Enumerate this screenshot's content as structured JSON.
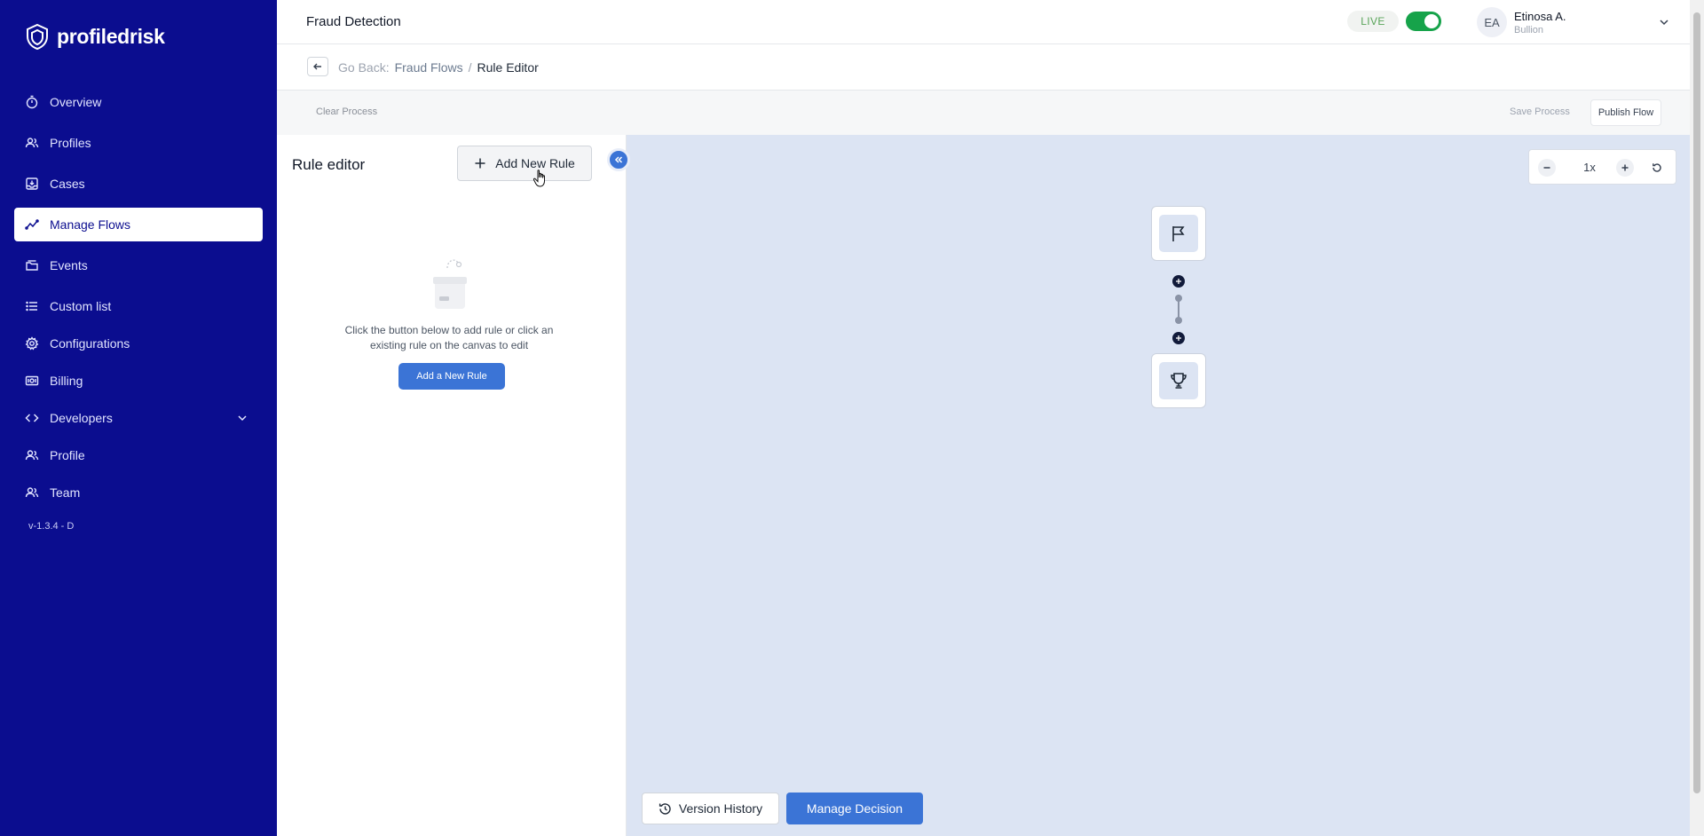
{
  "brand": {
    "name": "profiledrisk",
    "icon": "shield-logo-icon"
  },
  "sidebar": {
    "items": [
      {
        "label": "Overview",
        "icon": "stopwatch-icon"
      },
      {
        "label": "Profiles",
        "icon": "users-icon"
      },
      {
        "label": "Cases",
        "icon": "inbox-download-icon"
      },
      {
        "label": "Manage Flows",
        "icon": "trend-line-icon",
        "active": true
      },
      {
        "label": "Events",
        "icon": "folder-stack-icon"
      },
      {
        "label": "Custom list",
        "icon": "list-icon"
      },
      {
        "label": "Configurations",
        "icon": "gear-icon"
      },
      {
        "label": "Billing",
        "icon": "money-icon"
      },
      {
        "label": "Developers",
        "icon": "code-icon",
        "expandable": true
      },
      {
        "label": "Profile",
        "icon": "users-icon"
      },
      {
        "label": "Team",
        "icon": "users-icon"
      }
    ],
    "version": "v-1.3.4 - D"
  },
  "header": {
    "title": "Fraud Detection",
    "live_label": "LIVE",
    "live_enabled": true,
    "user": {
      "initials": "EA",
      "name": "Etinosa A.",
      "org": "Bullion"
    }
  },
  "breadcrumb": {
    "prefix": "Go Back:",
    "parent": "Fraud Flows",
    "separator": "/",
    "current": "Rule Editor"
  },
  "actions": {
    "clear_process": "Clear Process",
    "save_process": "Save Process",
    "publish_flow": "Publish Flow"
  },
  "rule_editor": {
    "title": "Rule editor",
    "add_rule_label": "Add New Rule",
    "empty_message": "Click the button below to add rule or click an existing rule on the canvas to edit",
    "add_a_new_rule_label": "Add a New Rule"
  },
  "canvas": {
    "zoom_level": "1x",
    "nodes": [
      {
        "type": "start",
        "icon": "flag-icon"
      },
      {
        "type": "end",
        "icon": "trophy-icon"
      }
    ],
    "version_history_label": "Version History",
    "manage_decision_label": "Manage Decision"
  },
  "colors": {
    "sidebar_bg": "#0b0d8f",
    "accent": "#3b74d6",
    "canvas_bg": "#dce4f3",
    "live_toggle": "#16a34a"
  }
}
